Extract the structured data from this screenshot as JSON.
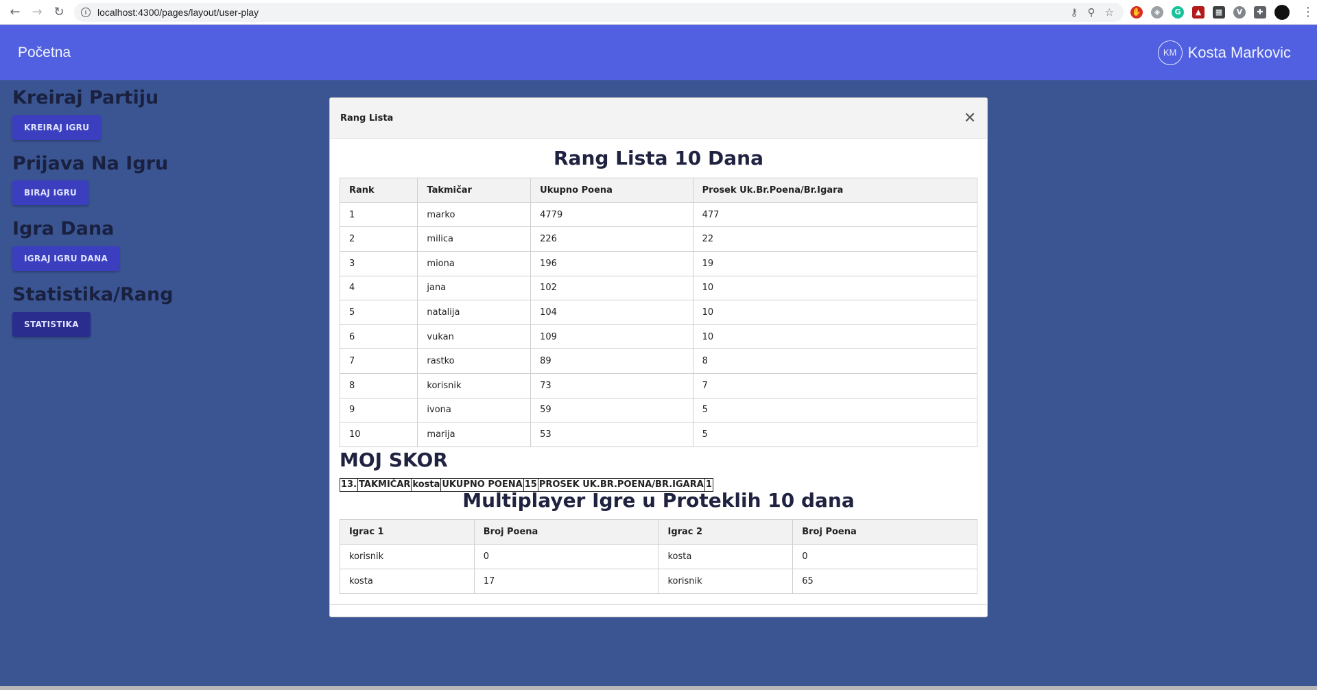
{
  "browser": {
    "url": "localhost:4300/pages/layout/user-play"
  },
  "header": {
    "brand": "Početna",
    "user_initials": "KM",
    "user_name": "Kosta Markovic"
  },
  "sidebar": {
    "sections": [
      {
        "title": "Kreiraj Partiju",
        "button": "KREIRAJ IGRU"
      },
      {
        "title": "Prijava Na Igru",
        "button": "BIRAJ IGRU"
      },
      {
        "title": "Igra Dana",
        "button": "IGRAJ IGRU DANA"
      },
      {
        "title": "Statistika/Rang",
        "button": "STATISTIKA"
      }
    ]
  },
  "modal": {
    "title": "Rang Lista",
    "rank_title": "Rang Lista 10 Dana",
    "rank_headers": [
      "Rank",
      "Takmičar",
      "Ukupno Poena",
      "Prosek Uk.Br.Poena/Br.Igara"
    ],
    "rank_rows": [
      [
        "1",
        "marko",
        "4779",
        "477"
      ],
      [
        "2",
        "milica",
        "226",
        "22"
      ],
      [
        "3",
        "miona",
        "196",
        "19"
      ],
      [
        "4",
        "jana",
        "102",
        "10"
      ],
      [
        "5",
        "natalija",
        "104",
        "10"
      ],
      [
        "6",
        "vukan",
        "109",
        "10"
      ],
      [
        "7",
        "rastko",
        "89",
        "8"
      ],
      [
        "8",
        "korisnik",
        "73",
        "7"
      ],
      [
        "9",
        "ivona",
        "59",
        "5"
      ],
      [
        "10",
        "marija",
        "53",
        "5"
      ]
    ],
    "my_score_title": "MOJ SKOR",
    "my_score_cells": [
      "13.",
      "TAKMIČAR",
      "kosta",
      "UKUPNO POENA",
      "15",
      "PROSEK UK.BR.POENA/BR.IGARA",
      "1"
    ],
    "mp_title": "Multiplayer Igre u Proteklih 10 dana",
    "mp_headers": [
      "Igrac 1",
      "Broj Poena",
      "Igrac 2",
      "Broj Poena"
    ],
    "mp_rows": [
      [
        "korisnik",
        "0",
        "kosta",
        "0"
      ],
      [
        "kosta",
        "17",
        "korisnik",
        "65"
      ]
    ]
  }
}
